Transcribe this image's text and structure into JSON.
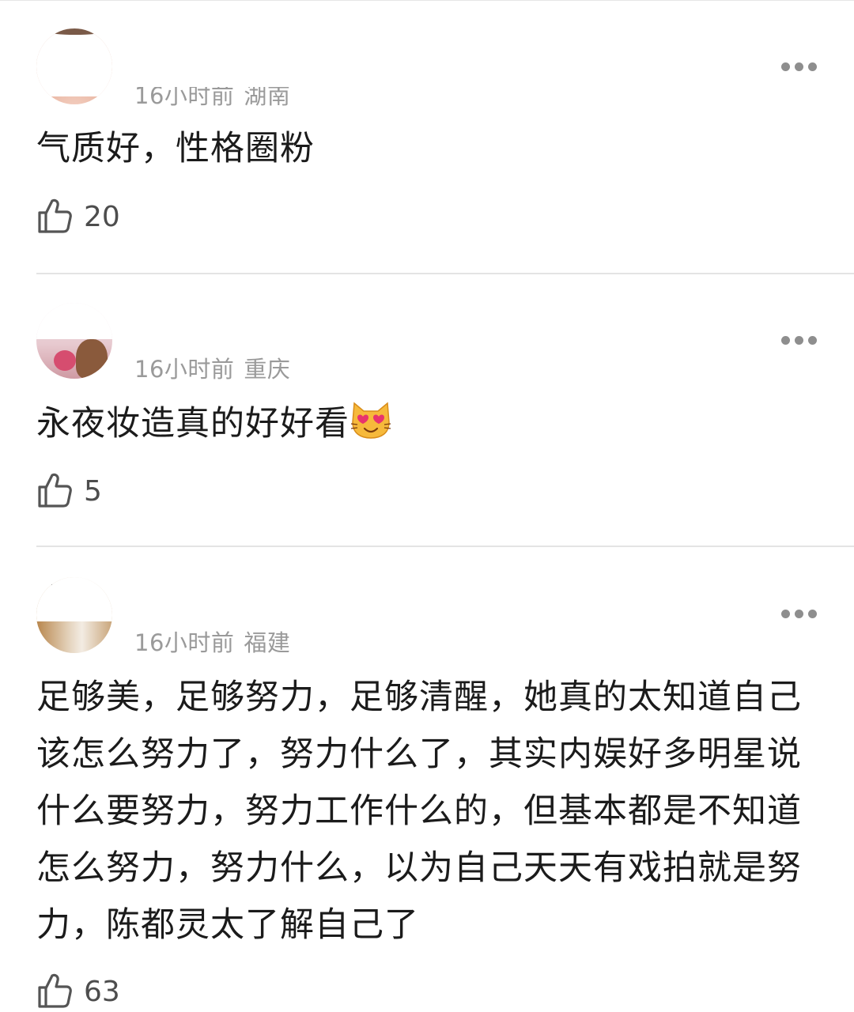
{
  "comments": [
    {
      "username": "",
      "time": "16小时前",
      "location": "湖南",
      "text": "气质好，性格圈粉",
      "likes": "20",
      "avatar_colors": {
        "top": "#d9a287",
        "bottom": "#f1c9bb"
      }
    },
    {
      "username": "",
      "time": "16小时前",
      "location": "重庆",
      "text": "永夜妆造真的好好看",
      "emoji": "smiling-cat-heart-eyes",
      "likes": "5",
      "avatar_colors": {
        "top": "#e8d2d7",
        "bottom": "#8a5a3c"
      }
    },
    {
      "username": "",
      "time": "16小时前",
      "location": "福建",
      "text": "足够美，足够努力，足够清醒，她真的太知道自己该怎么努力了，努力什么了，其实内娱好多明星说什么要努力，努力工作什么的，但基本都是不知道怎么努力，努力什么，以为自己天天有戏拍就是努力，陈都灵太了解自己了",
      "likes": "63",
      "avatar_colors": {
        "top": "#e9dccb",
        "bottom": "#b88a52"
      }
    }
  ],
  "icons": {
    "like": "thumbs-up-icon",
    "more": "more-dots-icon"
  },
  "colors": {
    "meta": "#9a9a9a",
    "divider": "#e4e4e4",
    "text": "#1b1b1b"
  }
}
